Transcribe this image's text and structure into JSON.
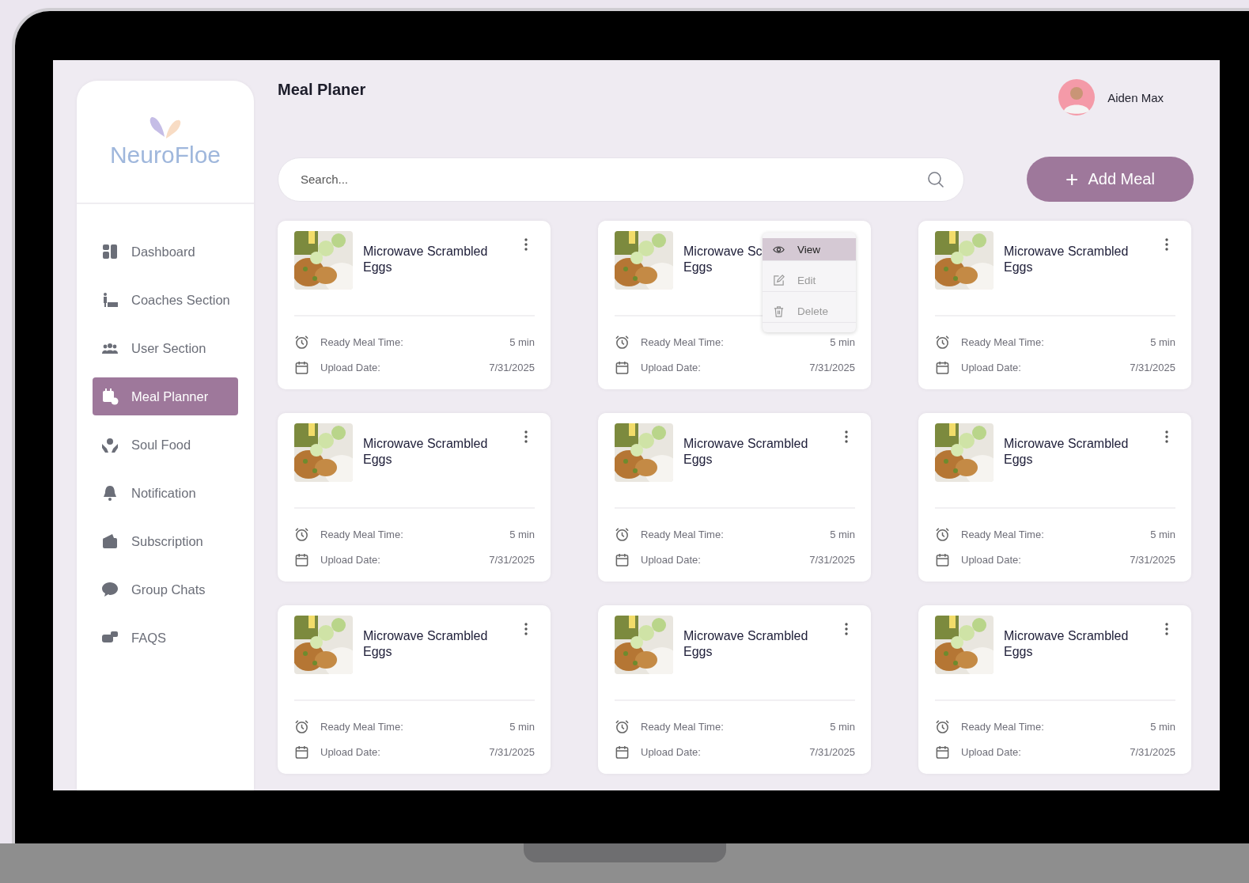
{
  "brand": {
    "name": "NeuroFloe"
  },
  "sidebar": {
    "items": [
      {
        "label": "Dashboard",
        "selected": false
      },
      {
        "label": "Coaches Section",
        "selected": false
      },
      {
        "label": "User Section",
        "selected": false
      },
      {
        "label": "Meal Planner",
        "selected": true
      },
      {
        "label": "Soul Food",
        "selected": false
      },
      {
        "label": "Notification",
        "selected": false
      },
      {
        "label": "Subscription",
        "selected": false
      },
      {
        "label": "Group Chats",
        "selected": false
      },
      {
        "label": "FAQS",
        "selected": false
      }
    ]
  },
  "header": {
    "title": "Meal Planer",
    "user": {
      "name": "Aiden Max"
    }
  },
  "search": {
    "placeholder": "Search..."
  },
  "add_button": {
    "label": "Add Meal",
    "icon": "+"
  },
  "cards": [
    {
      "title": "Microwave Scrambled\nEggs",
      "meta": [
        {
          "label": "Ready Meal Time:",
          "value": "5 min"
        },
        {
          "label": "Upload Date:",
          "value": "7/31/2025"
        }
      ]
    },
    {
      "title": "Microwave Sc\nEggs",
      "meta": [
        {
          "label": "Ready Meal Time:",
          "value": "5 min"
        },
        {
          "label": "Upload Date:",
          "value": "7/31/2025"
        }
      ],
      "menu": [
        {
          "label": "View",
          "selected": true
        },
        {
          "label": "Edit",
          "selected": false
        },
        {
          "label": "Delete",
          "selected": false
        }
      ]
    },
    {
      "title": "Microwave Scrambled\nEggs",
      "meta": [
        {
          "label": "Ready Meal Time:",
          "value": "5 min"
        },
        {
          "label": "Upload Date:",
          "value": "7/31/2025"
        }
      ]
    },
    {
      "title": "Microwave Scrambled\nEggs",
      "meta": [
        {
          "label": "Ready Meal Time:",
          "value": "5 min"
        },
        {
          "label": "Upload Date:",
          "value": "7/31/2025"
        }
      ]
    },
    {
      "title": "Microwave Scrambled\nEggs",
      "meta": [
        {
          "label": "Ready Meal Time:",
          "value": "5 min"
        },
        {
          "label": "Upload Date:",
          "value": "7/31/2025"
        }
      ]
    },
    {
      "title": "Microwave Scrambled\nEggs",
      "meta": [
        {
          "label": "Ready Meal Time:",
          "value": "5 min"
        },
        {
          "label": "Upload Date:",
          "value": "7/31/2025"
        }
      ]
    },
    {
      "title": "Microwave Scrambled\nEggs",
      "meta": [
        {
          "label": "Ready Meal Time:",
          "value": "5 min"
        },
        {
          "label": "Upload Date:",
          "value": "7/31/2025"
        }
      ]
    },
    {
      "title": "Microwave Scrambled\nEggs",
      "meta": [
        {
          "label": "Ready Meal Time:",
          "value": "5 min"
        },
        {
          "label": "Upload Date:",
          "value": "7/31/2025"
        }
      ]
    },
    {
      "title": "Microwave Scrambled\nEggs",
      "meta": [
        {
          "label": "Ready Meal Time:",
          "value": "5 min"
        },
        {
          "label": "Upload Date:",
          "value": "7/31/2025"
        }
      ]
    }
  ]
}
